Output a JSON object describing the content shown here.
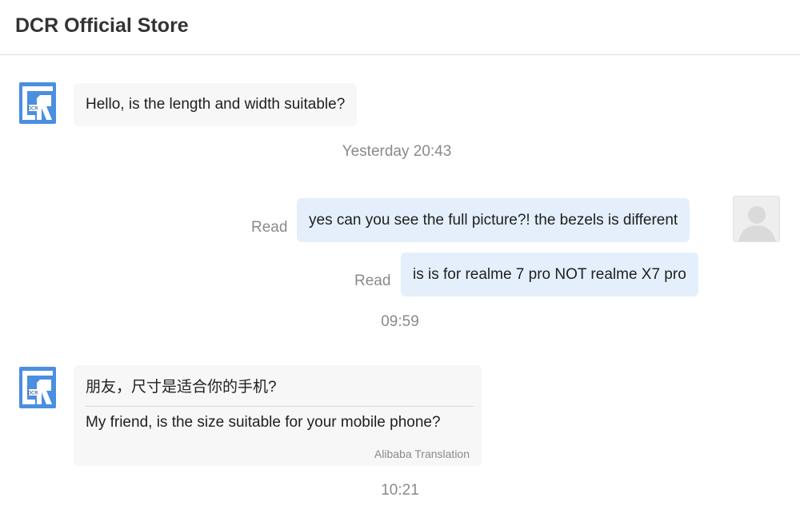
{
  "header": {
    "title": "DCR Official Store"
  },
  "store_avatar": {
    "logo_text": "DCR",
    "icon": "store-logo-icon",
    "color": "#4a8fe0"
  },
  "messages": [
    {
      "text": "Hello, is the length and width suitable?"
    },
    {
      "time": "Yesterday 20:43"
    },
    {
      "text": "yes can you see the full picture?! the bezels is different",
      "status": "Read"
    },
    {
      "text": "is is for realme 7 pro NOT realme X7 pro",
      "status": "Read"
    },
    {
      "time": "09:59"
    },
    {
      "original": "朋友，尺寸是适合你的手机?",
      "translation": "My friend, is the size suitable for your mobile phone?",
      "translation_source": "Alibaba Translation"
    },
    {
      "time": "10:21"
    }
  ],
  "colors": {
    "incoming_bg": "#f7f7f7",
    "outgoing_bg": "#e4effb",
    "muted_text": "#8a8a8a"
  }
}
